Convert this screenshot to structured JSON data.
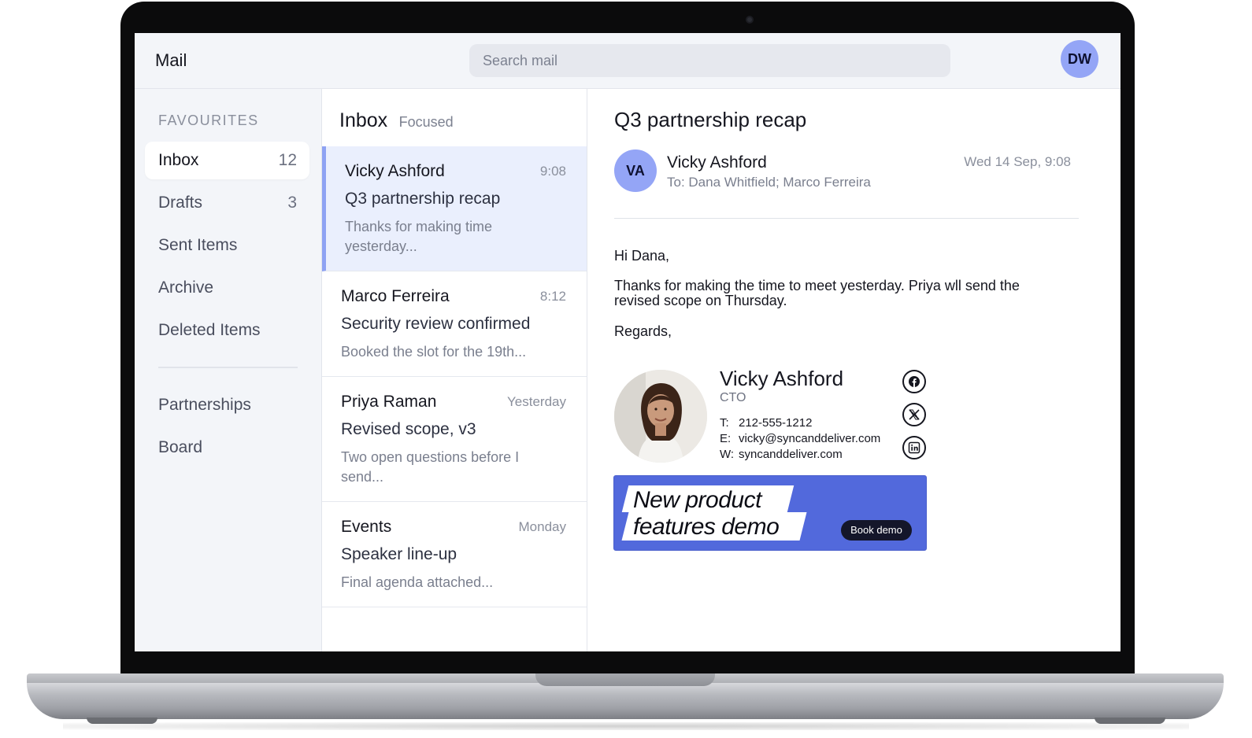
{
  "app": {
    "title": "Mail"
  },
  "search": {
    "placeholder": "Search mail"
  },
  "user": {
    "initials": "DW",
    "avatar_color": "#94a5f6"
  },
  "sidebar": {
    "heading": "FAVOURITES",
    "items": [
      {
        "label": "Inbox",
        "count": "12",
        "active": true
      },
      {
        "label": "Drafts",
        "count": "3"
      },
      {
        "label": "Sent Items"
      },
      {
        "label": "Archive"
      },
      {
        "label": "Deleted Items"
      }
    ],
    "groups": [
      {
        "label": "Partnerships"
      },
      {
        "label": "Board"
      }
    ]
  },
  "message_list": {
    "title": "Inbox",
    "filter": "Focused",
    "messages": [
      {
        "sender": "Vicky Ashford",
        "time": "9:08",
        "subject": "Q3 partnership recap",
        "preview": "Thanks for making time yesterday...",
        "selected": true
      },
      {
        "sender": "Marco Ferreira",
        "time": "8:12",
        "subject": "Security review confirmed",
        "preview": "Booked the slot for the 19th..."
      },
      {
        "sender": "Priya Raman",
        "time": "Yesterday",
        "subject": "Revised scope, v3",
        "preview": "Two open questions before I send..."
      },
      {
        "sender": "Events",
        "time": "Monday",
        "subject": "Speaker line-up",
        "preview": "Final agenda attached..."
      }
    ]
  },
  "reader": {
    "subject": "Q3 partnership recap",
    "sender_initials": "VA",
    "sender_name": "Vicky Ashford",
    "to": "To: Dana Whitfield; Marco Ferreira",
    "date": "Wed 14 Sep, 9:08",
    "body": {
      "greeting": "Hi Dana,",
      "line1": "Thanks for making the time to meet yesterday. Priya wll send the",
      "line2": "revised scope on Thursday.",
      "closing": "Regards,"
    },
    "signature": {
      "name": "Vicky Ashford",
      "title": "CTO",
      "phone_label": "T:",
      "phone": "212-555-1212",
      "email_label": "E:",
      "email": "vicky@syncanddeliver.com",
      "web_label": "W:",
      "web": "syncanddeliver.com",
      "social_icons": [
        "facebook-icon",
        "x-icon",
        "linkedin-icon"
      ]
    },
    "banner": {
      "line1": "New product",
      "line2": "features demo",
      "button": "Book demo",
      "background": "#5269dc"
    }
  },
  "colors": {
    "accent": "#8ea2f3",
    "selected_row": "#eaeffd",
    "chrome": "#f3f5f9"
  }
}
